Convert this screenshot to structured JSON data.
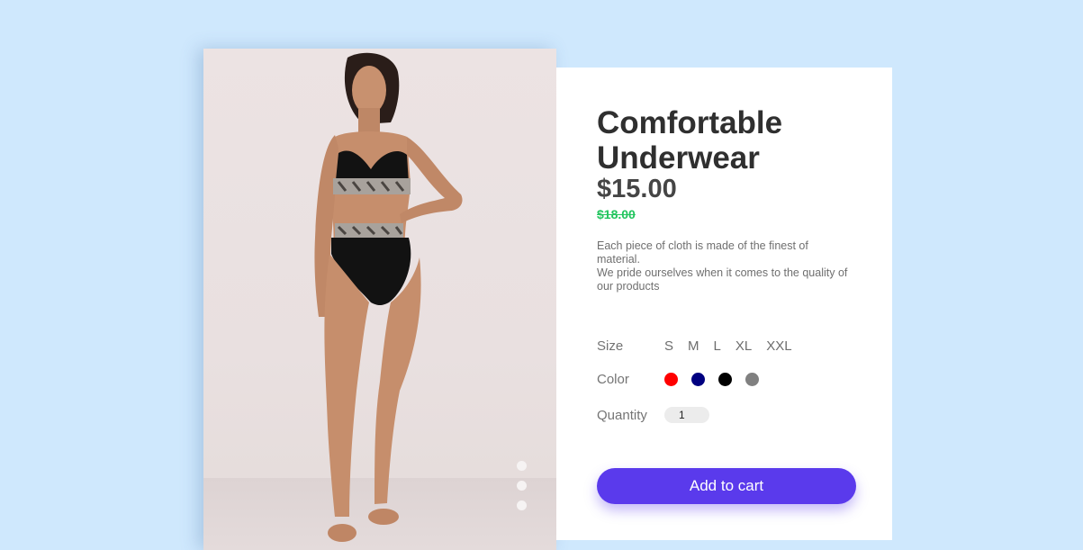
{
  "product": {
    "title": "Comfortable Underwear",
    "price": "$15.00",
    "old_price": "$18.00",
    "description": [
      "Each piece of cloth is made of the finest of material.",
      "We pride ourselves when it comes to the quality of our products"
    ]
  },
  "options": {
    "size_label": "Size",
    "sizes": [
      "S",
      "M",
      "L",
      "XL",
      "XXL"
    ],
    "color_label": "Color",
    "colors": [
      {
        "name": "red",
        "hex": "#ff0000"
      },
      {
        "name": "navy",
        "hex": "#000080"
      },
      {
        "name": "black",
        "hex": "#000000"
      },
      {
        "name": "gray",
        "hex": "#808080"
      }
    ],
    "quantity_label": "Quantity",
    "quantity_value": "1"
  },
  "cart": {
    "button_label": "Add to cart"
  },
  "theme": {
    "background": "#cfe8fd",
    "accent": "#5a3aec",
    "sale_green": "#22c55e"
  },
  "carousel": {
    "slide_count": 3
  }
}
